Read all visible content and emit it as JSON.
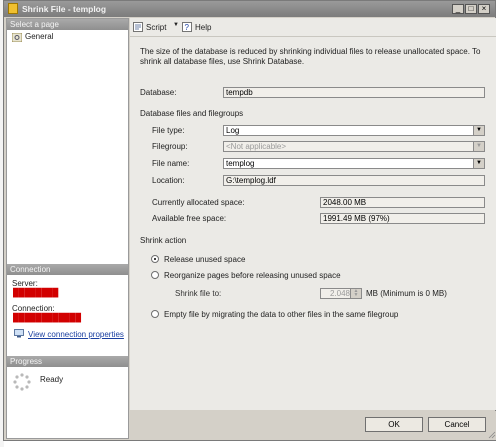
{
  "window": {
    "title": "Shrink File - templog",
    "controls": [
      "_",
      "□",
      "×"
    ]
  },
  "left_panel": {
    "select_page_header": "Select a page",
    "pages": [
      {
        "label": "General",
        "icon": "gear-icon"
      }
    ],
    "connection": {
      "header": "Connection",
      "server_label": "Server:",
      "server_value": "████████",
      "connection_label": "Connection:",
      "connection_value": "████████████",
      "view_link": "View connection properties"
    },
    "progress": {
      "header": "Progress",
      "status": "Ready"
    }
  },
  "toolbar": {
    "script_label": "Script",
    "help_label": "Help"
  },
  "main": {
    "description": "The size of the database is reduced by shrinking individual files to release unallocated space. To shrink all database files, use Shrink Database.",
    "database_label": "Database:",
    "database_value": "tempdb",
    "files_group_label": "Database files and filegroups",
    "file_type_label": "File type:",
    "file_type_value": "Log",
    "filegroup_label": "Filegroup:",
    "filegroup_value": "<Not applicable>",
    "file_name_label": "File name:",
    "file_name_value": "templog",
    "location_label": "Location:",
    "location_value": "G:\\templog.ldf",
    "allocated_label": "Currently allocated space:",
    "allocated_value": "2048.00 MB",
    "free_label": "Available free space:",
    "free_value": "1991.49 MB (97%)",
    "shrink_action_label": "Shrink action",
    "option_release": "Release unused space",
    "option_reorganize": "Reorganize pages before releasing unused space",
    "shrink_to_label": "Shrink file to:",
    "shrink_to_value": "2.048",
    "shrink_to_unit": "MB (Minimum is 0 MB)",
    "option_empty": "Empty file by migrating the data to other files in the same filegroup",
    "selected_option": "release"
  },
  "buttons": {
    "ok": "OK",
    "cancel": "Cancel"
  }
}
